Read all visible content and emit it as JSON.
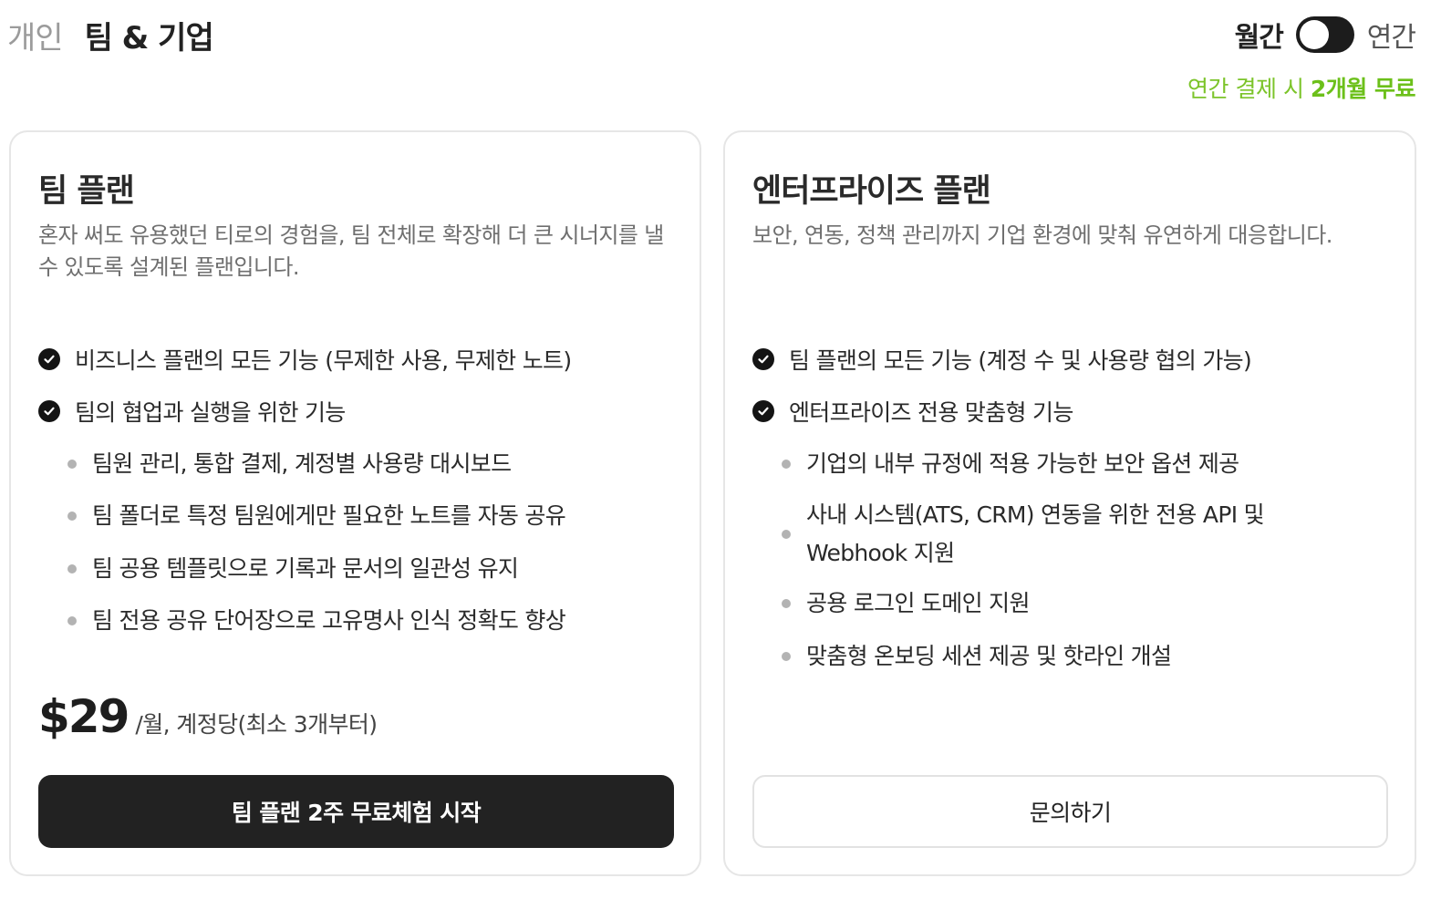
{
  "tabs": [
    {
      "label": "개인",
      "active": false
    },
    {
      "label": "팀 & 기업",
      "active": true
    }
  ],
  "billing": {
    "monthly_label": "월간",
    "yearly_label": "연간",
    "toggle_state": "monthly",
    "promo_prefix": "연간 결제 시 ",
    "promo_highlight": "2개월 무료"
  },
  "plans": {
    "team": {
      "title": "팀 플랜",
      "description": "혼자 써도 유용했던 티로의 경험을, 팀 전체로 확장해 더 큰 시너지를 낼 수 있도록 설계된 플랜입니다.",
      "features": [
        "비즈니스 플랜의 모든 기능 (무제한 사용, 무제한 노트)",
        "팀의 협업과 실행을 위한 기능"
      ],
      "sub_features": [
        "팀원 관리, 통합 결제, 계정별 사용량 대시보드",
        "팀 폴더로 특정 팀원에게만 필요한 노트를 자동 공유",
        "팀 공용 템플릿으로 기록과 문서의 일관성 유지",
        "팀 전용 공유 단어장으로 고유명사 인식 정확도 향상"
      ],
      "price": "$29",
      "price_unit": "/월, 계정당(최소 3개부터)",
      "cta": "팀 플랜 2주 무료체험 시작"
    },
    "enterprise": {
      "title": "엔터프라이즈 플랜",
      "description": "보안, 연동, 정책 관리까지 기업 환경에 맞춰 유연하게 대응합니다.",
      "features": [
        "팀 플랜의 모든 기능 (계정 수 및 사용량 협의 가능)",
        "엔터프라이즈 전용 맞춤형 기능"
      ],
      "sub_features": [
        "기업의 내부 규정에 적용 가능한 보안 옵션 제공",
        "사내 시스템(ATS, CRM) 연동을 위한 전용 API 및 Webhook 지원",
        "공용 로그인 도메인 지원",
        "맞춤형 온보딩 세션 제공 및 핫라인 개설"
      ],
      "cta": "문의하기"
    }
  },
  "colors": {
    "accent_green": "#7cc42a",
    "primary_button": "#222222",
    "check_icon": "#141414"
  }
}
